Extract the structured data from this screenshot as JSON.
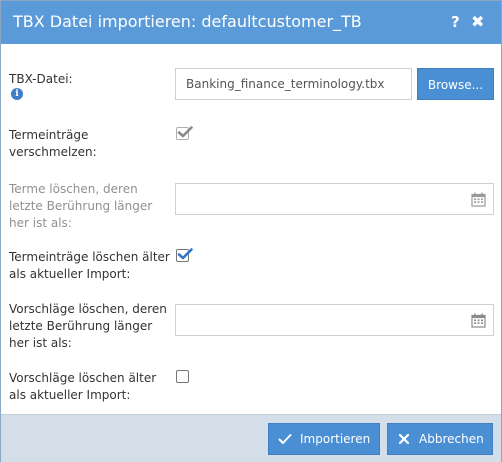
{
  "dialog": {
    "title": "TBX Datei importieren: defaultcustomer_TB",
    "help_icon": "?",
    "close_icon": "✖"
  },
  "fields": {
    "tbx_file": {
      "label": "TBX-Datei:",
      "info_icon": "i",
      "value": "Banking_finance_terminology.tbx",
      "browse_label": "Browse..."
    },
    "merge_terms": {
      "label_line1": "Termeinträge",
      "label_line2": "verschmelzen:",
      "checked": true,
      "state": "checked-disabled"
    },
    "delete_terms_older_than": {
      "label_line1": "Terme löschen, deren",
      "label_line2": "letzte Berührung länger",
      "label_line3": "her ist als:",
      "value": "",
      "icon": "calendar-icon"
    },
    "delete_terms_older_import": {
      "label_line1": "Termeinträge löschen älter",
      "label_line2": "als aktueller Import:",
      "checked": true
    },
    "delete_proposals_older_than": {
      "label_line1": "Vorschläge löschen, deren",
      "label_line2": "letzte Berührung länger",
      "label_line3": "her ist als:",
      "value": "",
      "icon": "calendar-icon"
    },
    "delete_proposals_older_import": {
      "label_line1": "Vorschläge löschen älter",
      "label_line2": "als aktueller Import:",
      "checked": false
    }
  },
  "footer": {
    "import_label": "Importieren",
    "cancel_label": "Abbrechen"
  },
  "colors": {
    "titlebar": "#5a9ad8",
    "button": "#4a8fd4",
    "footer": "#d4dee8",
    "checkmark_active": "#2f76c6",
    "checkmark_disabled": "#8a8a8a"
  }
}
